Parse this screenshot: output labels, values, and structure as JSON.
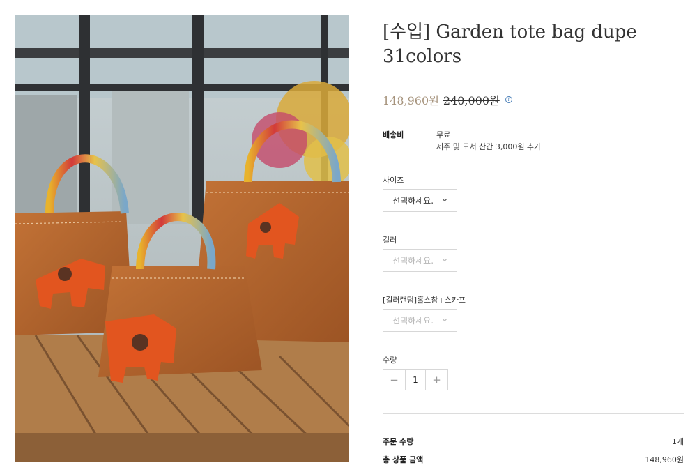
{
  "product": {
    "title_line1": "[수입] Garden tote bag dupe",
    "title_line2": "31colors",
    "sale_price": "148,960원",
    "original_price": "240,000원",
    "price_info_icon": "info-circle-icon"
  },
  "shipping": {
    "label": "배송비",
    "value": "무료",
    "note": "제주 및 도서 산간 3,000원 추가"
  },
  "options": {
    "size": {
      "label": "사이즈",
      "placeholder": "선택하세요.",
      "state": "enabled"
    },
    "color": {
      "label": "컬러",
      "placeholder": "선택하세요.",
      "state": "disabled"
    },
    "charm": {
      "label": "[컬러랜덤]홀스참+스카프",
      "placeholder": "선택하세요.",
      "state": "disabled"
    }
  },
  "quantity": {
    "label": "수량",
    "value": "1",
    "minus_icon": "minus-icon",
    "plus_icon": "plus-icon"
  },
  "summary": {
    "order_qty_label": "주문 수량",
    "order_qty_value": "1개",
    "total_label": "총 상품 금액",
    "total_value": "148,960원"
  },
  "colors": {
    "sale_price": "#a6937c",
    "bag_leather": "#b5652a",
    "horse_charm": "#e2551f"
  }
}
